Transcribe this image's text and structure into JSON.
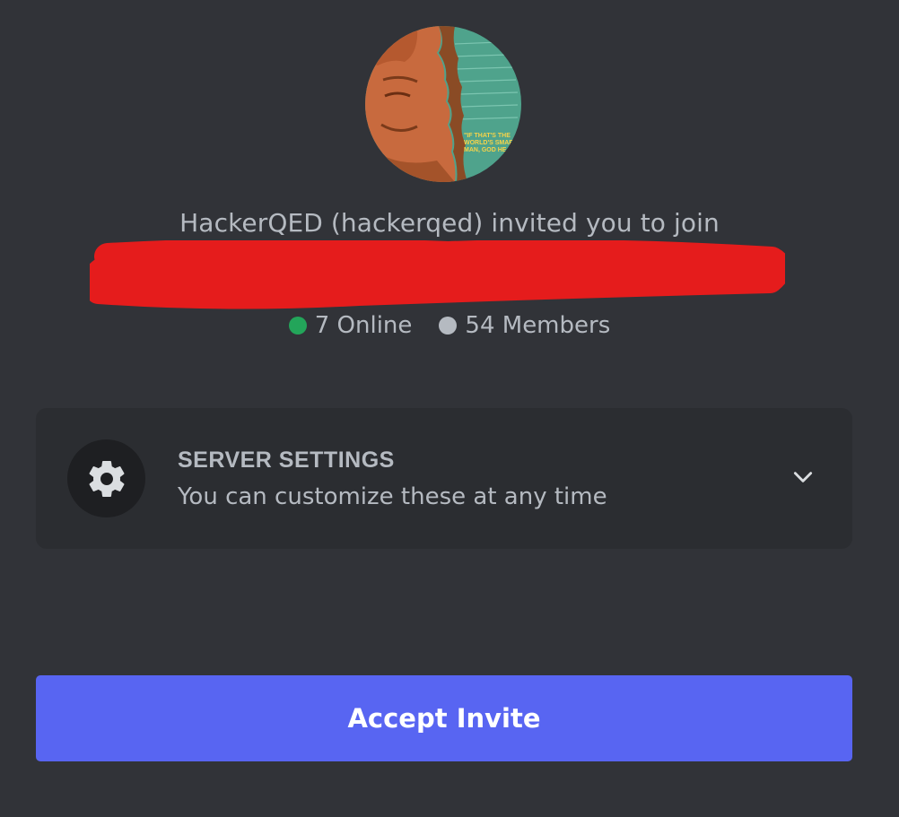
{
  "invite": {
    "text": "HackerQED (hackerqed) invited you to join",
    "avatar_quote_lines": [
      "\"IF THAT'S THE",
      "WORLD'S SMART",
      "MAN, GOD HE"
    ]
  },
  "stats": {
    "online": "7 Online",
    "members": "54 Members",
    "online_color": "#23a55a",
    "members_color": "#b5bac1"
  },
  "settings": {
    "title": "SERVER SETTINGS",
    "description": "You can customize these at any time",
    "icon": "gear-icon",
    "expand_icon": "chevron-down-icon"
  },
  "actions": {
    "accept_label": "Accept Invite"
  },
  "colors": {
    "background": "#313338",
    "card": "#2b2d31",
    "accent": "#5865f2",
    "redaction": "#e51c1c"
  }
}
